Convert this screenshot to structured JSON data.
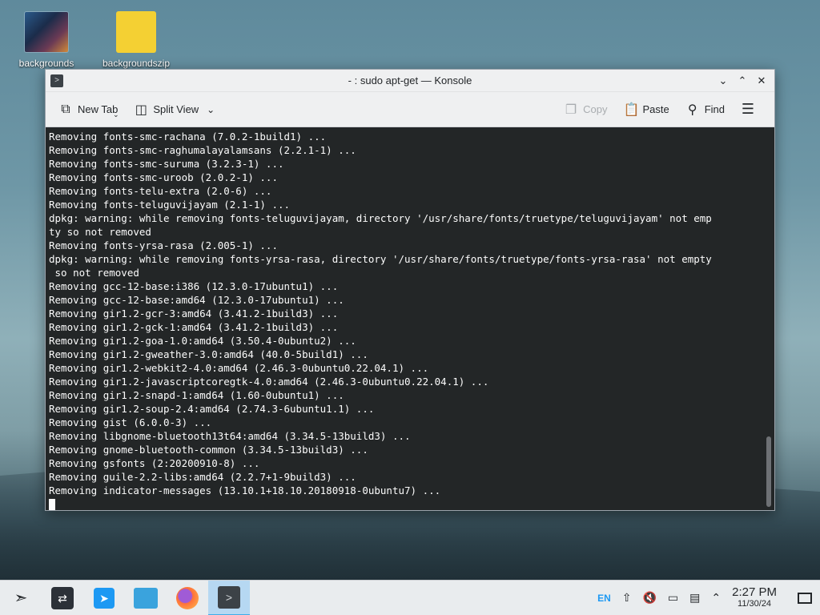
{
  "desktop": {
    "icons": [
      {
        "label": "backgrounds",
        "icon": "image-folder-icon"
      },
      {
        "label": "backgroundszip",
        "icon": "zip-archive-icon"
      }
    ]
  },
  "window": {
    "title": "- : sudo apt-get — Konsole",
    "toolbar": {
      "new_tab": "New Tab",
      "split_view": "Split View",
      "copy": "Copy",
      "paste": "Paste",
      "find": "Find"
    },
    "terminal_lines": [
      "Removing fonts-smc-rachana (7.0.2-1build1) ...",
      "Removing fonts-smc-raghumalayalamsans (2.2.1-1) ...",
      "Removing fonts-smc-suruma (3.2.3-1) ...",
      "Removing fonts-smc-uroob (2.0.2-1) ...",
      "Removing fonts-telu-extra (2.0-6) ...",
      "Removing fonts-teluguvijayam (2.1-1) ...",
      "dpkg: warning: while removing fonts-teluguvijayam, directory '/usr/share/fonts/truetype/teluguvijayam' not emp",
      "ty so not removed",
      "Removing fonts-yrsa-rasa (2.005-1) ...",
      "dpkg: warning: while removing fonts-yrsa-rasa, directory '/usr/share/fonts/truetype/fonts-yrsa-rasa' not empty",
      " so not removed",
      "Removing gcc-12-base:i386 (12.3.0-17ubuntu1) ...",
      "Removing gcc-12-base:amd64 (12.3.0-17ubuntu1) ...",
      "Removing gir1.2-gcr-3:amd64 (3.41.2-1build3) ...",
      "Removing gir1.2-gck-1:amd64 (3.41.2-1build3) ...",
      "Removing gir1.2-goa-1.0:amd64 (3.50.4-0ubuntu2) ...",
      "Removing gir1.2-gweather-3.0:amd64 (40.0-5build1) ...",
      "Removing gir1.2-webkit2-4.0:amd64 (2.46.3-0ubuntu0.22.04.1) ...",
      "Removing gir1.2-javascriptcoregtk-4.0:amd64 (2.46.3-0ubuntu0.22.04.1) ...",
      "Removing gir1.2-snapd-1:amd64 (1.60-0ubuntu1) ...",
      "Removing gir1.2-soup-2.4:amd64 (2.74.3-6ubuntu1.1) ...",
      "Removing gist (6.0.0-3) ...",
      "Removing libgnome-bluetooth13t64:amd64 (3.34.5-13build3) ...",
      "Removing gnome-bluetooth-common (3.34.5-13build3) ...",
      "Removing gsfonts (2:20200910-8) ...",
      "Removing guile-2.2-libs:amd64 (2.2.7+1-9build3) ...",
      "Removing indicator-messages (13.10.1+18.10.20180918-0ubuntu7) ..."
    ]
  },
  "taskbar": {
    "tray": {
      "language": "EN",
      "time": "2:27 PM",
      "date": "11/30/24"
    }
  },
  "colors": {
    "accent": "#3daee9",
    "terminal_bg": "#232627",
    "terminal_fg": "#fcfcfc"
  }
}
